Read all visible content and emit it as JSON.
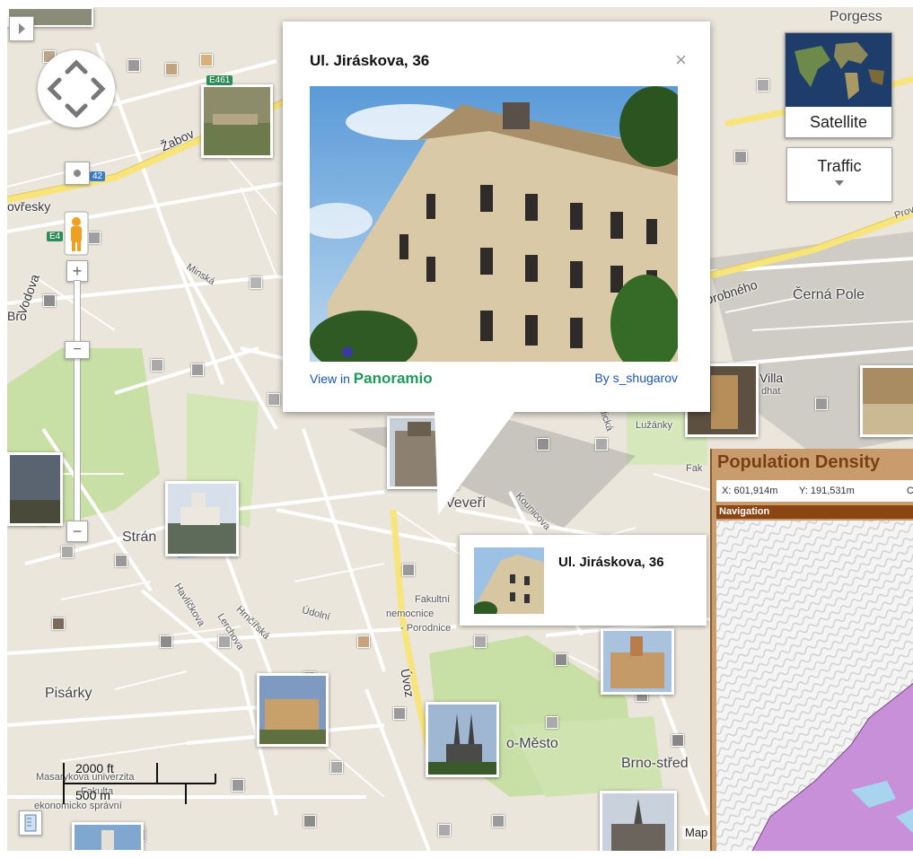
{
  "info_window": {
    "title": "Ul. Jiráskova, 36",
    "close_glyph": "×",
    "view_prefix": "View in",
    "view_brand": "Panoramio",
    "author": "By s_shugarov"
  },
  "tooltip": {
    "title": "Ul. Jiráskova, 36"
  },
  "controls": {
    "satellite_label": "Satellite",
    "traffic_label": "Traffic",
    "zoom_in": "+",
    "zoom_out": "−",
    "zoom_out_bottom": "−"
  },
  "place_labels": {
    "porgess": "Porgess",
    "zabov": "Žabov",
    "ovresky": "ovřesky",
    "minska": "Minská",
    "drobneho": "Drobného",
    "cerna_pole": "Černá Pole",
    "villa": "Villa",
    "tugendhat": "dhat",
    "luzanky": "Lužánky",
    "veveri": "Veveří",
    "stranska": "Strán",
    "havlickova": "Havlíčkova",
    "lerchova": "Lerchova",
    "hrnchova": "Hrnčířská",
    "udolni": "Údolní",
    "fakultni": "Fakultní",
    "nemocnice": "nemocnice",
    "porodnice": "- Porodnice",
    "uvoz": "Úvoz",
    "pisarky": "Pisárky",
    "mesto": "o-Město",
    "brno_stred": "Brno-střed",
    "masaryk": "Masarykova univerzita",
    "fakulta": "Fakulta",
    "ekonomicko": "ekonomicko správní",
    "kounicova": "Kounicova",
    "ludicka": "Ludická",
    "prova": "Prova",
    "vodova": "Vodova",
    "bro": "Bro",
    "e461": "E461",
    "r42": "42",
    "e4": "E4",
    "fak": "Fak",
    "map_attr": "Map"
  },
  "scale": {
    "imperial": "2000 ft",
    "metric": "500 m"
  },
  "population_panel": {
    "title": "Population Density",
    "x_coord": "X: 601,914m",
    "y_coord": "Y: 191,531m",
    "extra": "C",
    "nav_label": "Navigation"
  },
  "colors": {
    "map_bg": "#ebe6dc",
    "road_yellow": "#f7e47a",
    "park_green": "#c8dfa6",
    "panoramio_green": "#1e9a5a",
    "link_blue": "#1a55b8",
    "panel_brown": "#8b4513",
    "density_purple": "#c890d8"
  },
  "icons": [
    "pan-control-icon",
    "pegman-icon",
    "zoom-in-icon",
    "zoom-out-icon",
    "close-icon",
    "ruler-icon",
    "expand-arrow-icon",
    "dropdown-arrow-icon"
  ]
}
